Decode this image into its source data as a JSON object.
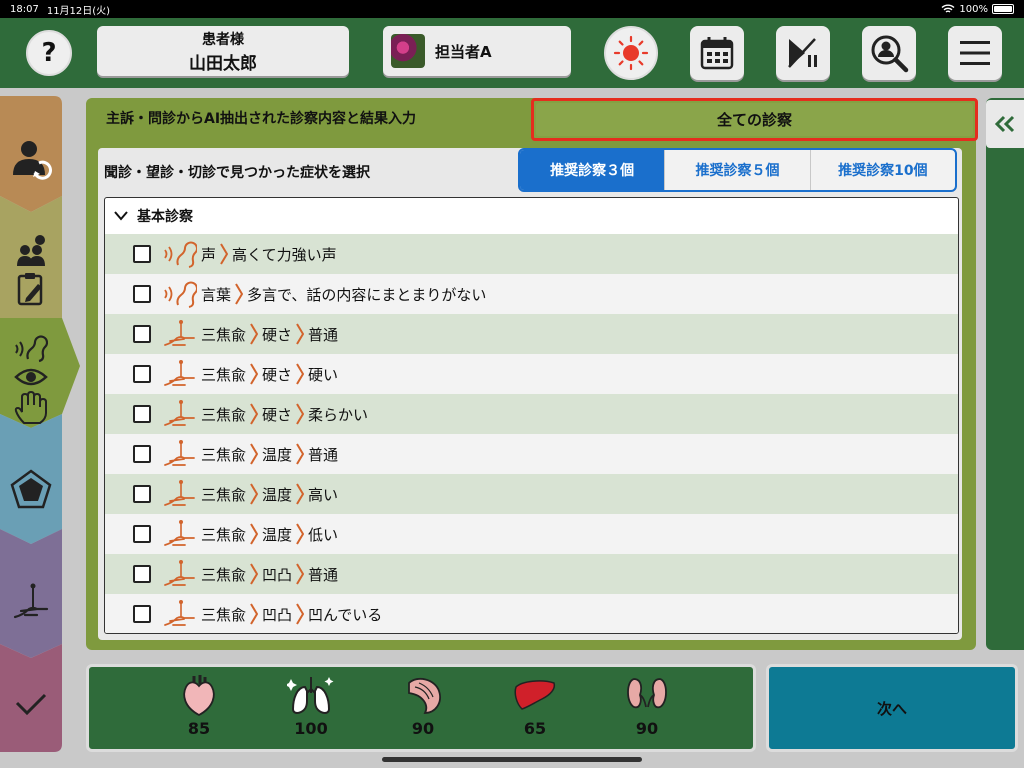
{
  "status_bar": {
    "time": "18:07",
    "date": "11月12日(火)",
    "battery": "100%"
  },
  "header": {
    "help_label": "?",
    "patient_label": "患者様",
    "patient_name": "山田太郎",
    "staff_name": "担当者A"
  },
  "panel": {
    "title": "主訴・問診からAI抽出された診察内容と結果入力",
    "all_tab": "全ての診察",
    "subtitle": "聞診・望診・切診で見つかった症状を選択",
    "segments": [
      "推奨診察３個",
      "推奨診察５個",
      "推奨診察10個"
    ],
    "section_title": "基本診察"
  },
  "rows": [
    {
      "icon": "ear-icon",
      "parts": [
        "声",
        "高くて力強い声"
      ]
    },
    {
      "icon": "ear-icon",
      "parts": [
        "言葉",
        "多言で、話の内容にまとまりがない"
      ]
    },
    {
      "icon": "palpation-icon",
      "parts": [
        "三焦兪",
        "硬さ",
        "普通"
      ]
    },
    {
      "icon": "palpation-icon",
      "parts": [
        "三焦兪",
        "硬さ",
        "硬い"
      ]
    },
    {
      "icon": "palpation-icon",
      "parts": [
        "三焦兪",
        "硬さ",
        "柔らかい"
      ]
    },
    {
      "icon": "palpation-icon",
      "parts": [
        "三焦兪",
        "温度",
        "普通"
      ]
    },
    {
      "icon": "palpation-icon",
      "parts": [
        "三焦兪",
        "温度",
        "高い"
      ]
    },
    {
      "icon": "palpation-icon",
      "parts": [
        "三焦兪",
        "温度",
        "低い"
      ]
    },
    {
      "icon": "palpation-icon",
      "parts": [
        "三焦兪",
        "凹凸",
        "普通"
      ]
    },
    {
      "icon": "palpation-icon",
      "parts": [
        "三焦兪",
        "凹凸",
        "凹んでいる"
      ]
    }
  ],
  "organs": [
    {
      "name": "heart",
      "value": "85"
    },
    {
      "name": "lungs",
      "value": "100"
    },
    {
      "name": "spleen",
      "value": "90"
    },
    {
      "name": "liver",
      "value": "65"
    },
    {
      "name": "kidneys",
      "value": "90"
    }
  ],
  "next_label": "次へ",
  "colors": {
    "header": "#2f6b3a",
    "panel": "#7f9a3e",
    "accent_blue": "#1a6fcc",
    "highlight_red": "#e52d1e",
    "next": "#0d7a94"
  }
}
